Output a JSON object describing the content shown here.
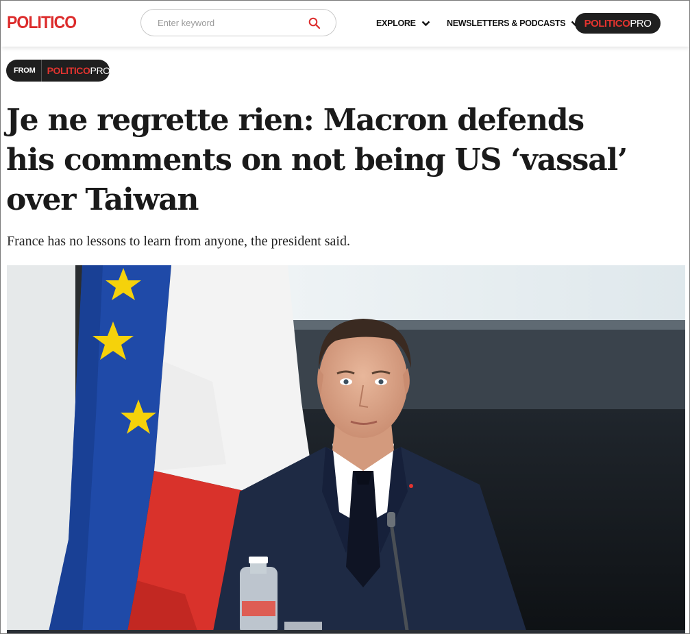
{
  "header": {
    "logo": "POLITICO",
    "search": {
      "placeholder": "Enter keyword",
      "value": ""
    },
    "nav": [
      {
        "label": "EXPLORE"
      },
      {
        "label": "NEWSLETTERS & PODCASTS"
      }
    ],
    "pro_button": {
      "brand": "POLITICO",
      "suffix": "PRO"
    }
  },
  "article": {
    "source_badge": {
      "prefix": "FROM",
      "brand": "POLITICO",
      "suffix": "PRO"
    },
    "headline": "Je ne regrette rien: Macron defends his comments on not being US ‘vassal’ over Taiwan",
    "dek": "France has no lessons to learn from anyone, the president said."
  },
  "colors": {
    "brand_red": "#dc2b2b",
    "pill_dark": "#1f1f1f",
    "eu_blue": "#1f4aa8",
    "eu_star": "#f5d20b",
    "fr_red": "#d9322b"
  },
  "icons": [
    "search-icon",
    "chevron-down-icon"
  ]
}
